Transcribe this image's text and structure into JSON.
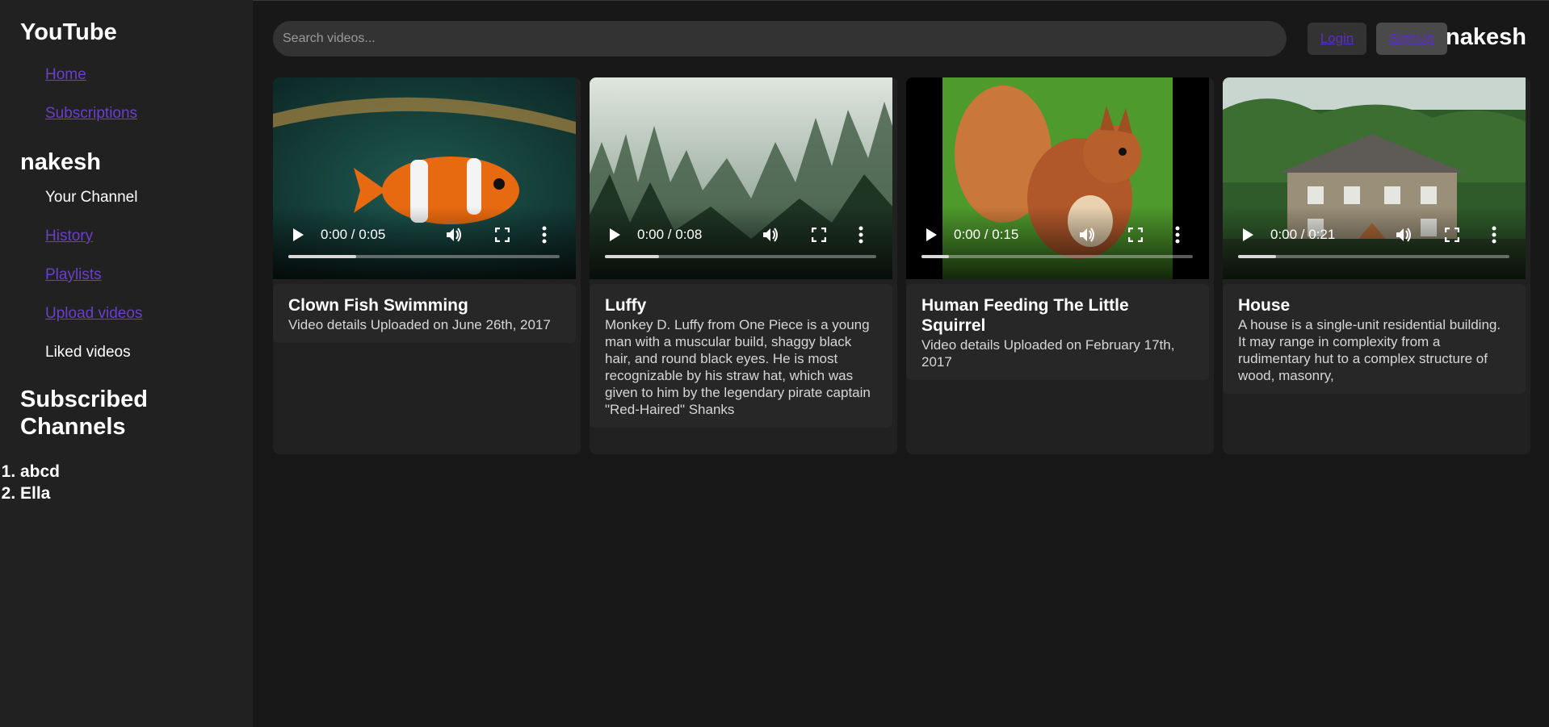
{
  "sidebar": {
    "brand": "YouTube",
    "links": [
      {
        "label": "Home"
      },
      {
        "label": "Subscriptions"
      }
    ],
    "user_heading": "nakesh",
    "user_items": [
      {
        "label": "Your Channel"
      },
      {
        "label": "History"
      },
      {
        "label": "Playlists"
      },
      {
        "label": "Upload videos"
      },
      {
        "label": "Liked videos"
      }
    ],
    "subscribed_heading": "Subscribed Channels",
    "subscribed": [
      "abcd",
      "Ella"
    ]
  },
  "header": {
    "search_placeholder": "Search videos...",
    "login_label": "Login",
    "signup_label": "SignUp",
    "username": "nakesh"
  },
  "videos": [
    {
      "title": "Clown Fish Swimming",
      "description": "Video details Uploaded on June 26th, 2017",
      "time": "0:00 / 0:05",
      "progress": 0.25,
      "thumbnail": "clownfish"
    },
    {
      "title": "Luffy",
      "description": "Monkey D. Luffy from One Piece is a young man with a muscular build, shaggy black hair, and round black eyes. He is most recognizable by his straw hat, which was given to him by the legendary pirate captain \"Red-Haired\" Shanks",
      "time": "0:00 / 0:08",
      "progress": 0.2,
      "thumbnail": "misty-forest"
    },
    {
      "title": "Human Feeding The Little Squirrel",
      "description": "Video details Uploaded on February 17th, 2017",
      "time": "0:00 / 0:15",
      "progress": 0.1,
      "thumbnail": "squirrel"
    },
    {
      "title": "House",
      "description": "A house is a single-unit residential building. It may range in complexity from a rudimentary hut to a complex structure of wood, masonry,",
      "time": "0:00 / 0:21",
      "progress": 0.14,
      "thumbnail": "house"
    }
  ],
  "colors": {
    "background": "#181818",
    "sidebar": "#212121",
    "link": "#6a3fc9"
  }
}
